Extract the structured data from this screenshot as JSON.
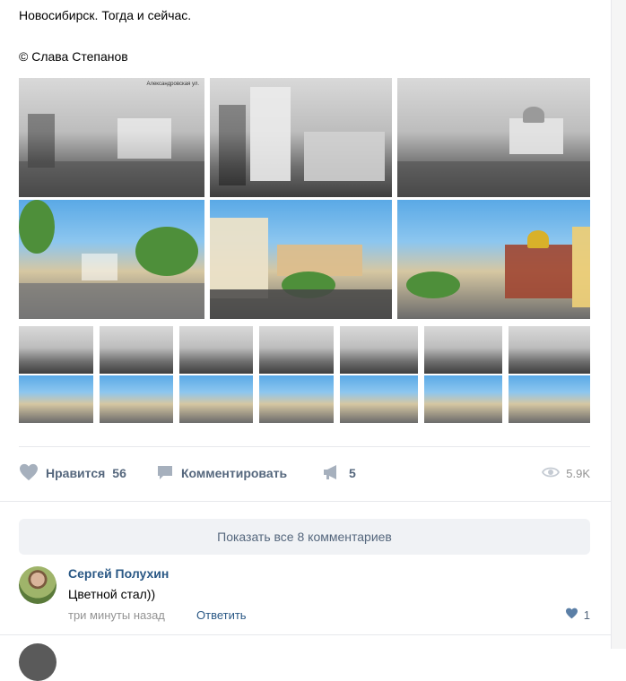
{
  "post": {
    "text": "Новосибирск. Тогда и сейчас.",
    "credit": "© Слава Степанов"
  },
  "photos": {
    "large": [
      {
        "type": "bw",
        "caption": "Александровская ул.",
        "icon": "street-photo"
      },
      {
        "type": "bw",
        "icon": "building-photo"
      },
      {
        "type": "bw",
        "icon": "cathedral-photo"
      },
      {
        "type": "color",
        "icon": "street-photo"
      },
      {
        "type": "color",
        "icon": "building-photo"
      },
      {
        "type": "color",
        "icon": "cathedral-photo"
      }
    ],
    "small_count": 14
  },
  "actions": {
    "like_label": "Нравится",
    "like_count": "56",
    "comment_label": "Комментировать",
    "share_count": "5",
    "views": "5.9K"
  },
  "comments": {
    "show_all_label": "Показать все 8 комментариев",
    "items": [
      {
        "author": "Сергей Полухин",
        "text": "Цветной стал))",
        "time": "три минуты назад",
        "reply_label": "Ответить",
        "likes": "1"
      }
    ]
  },
  "colors": {
    "link": "#2a5885",
    "action": "#55677d",
    "muted": "#939393",
    "button_bg": "#f0f2f5"
  }
}
